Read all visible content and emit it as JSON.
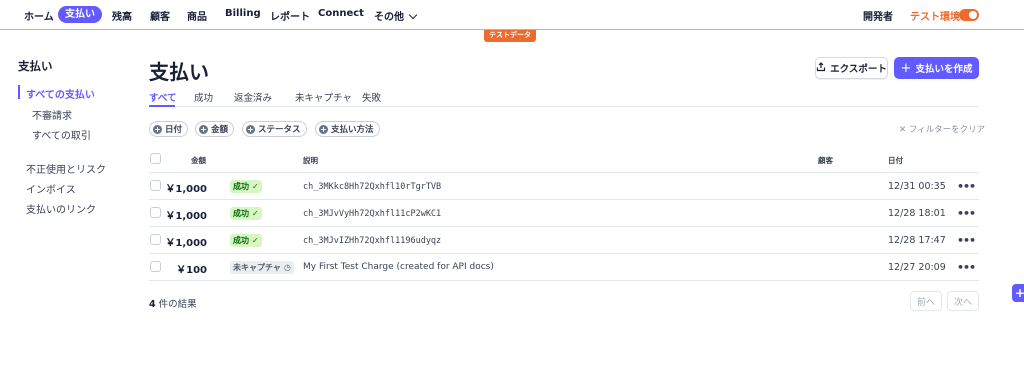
{
  "nav": {
    "home": "ホーム",
    "payments": "支払い",
    "balances": "残高",
    "customers": "顧客",
    "products": "商品",
    "billing": "Billing",
    "reports": "レポート",
    "connect": "Connect",
    "more": "その他",
    "developers": "開発者",
    "test_mode": "テスト環境"
  },
  "test_data_tag": "テストデータ",
  "sidebar": {
    "title": "支払い",
    "items": [
      "すべての支払い",
      "不審請求",
      "すべての取引",
      "不正使用とリスク",
      "インボイス",
      "支払いのリンク"
    ]
  },
  "page": {
    "title": "支払い",
    "export_label": "エクスポート",
    "create_label": "支払いを作成"
  },
  "tabs": [
    "すべて",
    "成功",
    "返金済み",
    "未キャプチャ",
    "失敗"
  ],
  "filters": {
    "chips": [
      "日付",
      "金額",
      "ステータス",
      "支払い方法"
    ],
    "clear": "フィルターをクリア"
  },
  "table": {
    "headers": {
      "amount": "金額",
      "description": "説明",
      "customer": "顧客",
      "date": "日付"
    },
    "rows": [
      {
        "amount": "￥1,000",
        "status": "成功",
        "description": "ch_3MKkc8Hh72Qxhfl10rTgrTVB",
        "customer": "",
        "date": "12/31 00:35"
      },
      {
        "amount": "￥1,000",
        "status": "成功",
        "description": "ch_3MJvVyHh72Qxhfl11cP2wKC1",
        "customer": "",
        "date": "12/28 18:01"
      },
      {
        "amount": "￥1,000",
        "status": "成功",
        "description": "ch_3MJvIZHh72Qxhfl1196udyqz",
        "customer": "",
        "date": "12/28 17:47"
      },
      {
        "amount": "￥100",
        "status": "未キャプチャ",
        "description": "My First Test Charge (created for API docs)",
        "customer": "",
        "date": "12/27 20:09"
      }
    ]
  },
  "results": {
    "count": "4",
    "suffix": "件の結果"
  },
  "pagination": {
    "prev": "前へ",
    "next": "次へ"
  },
  "colors": {
    "accent": "#635bff",
    "test_orange": "#ed6c2d",
    "success_bg": "#d7f7c2"
  }
}
